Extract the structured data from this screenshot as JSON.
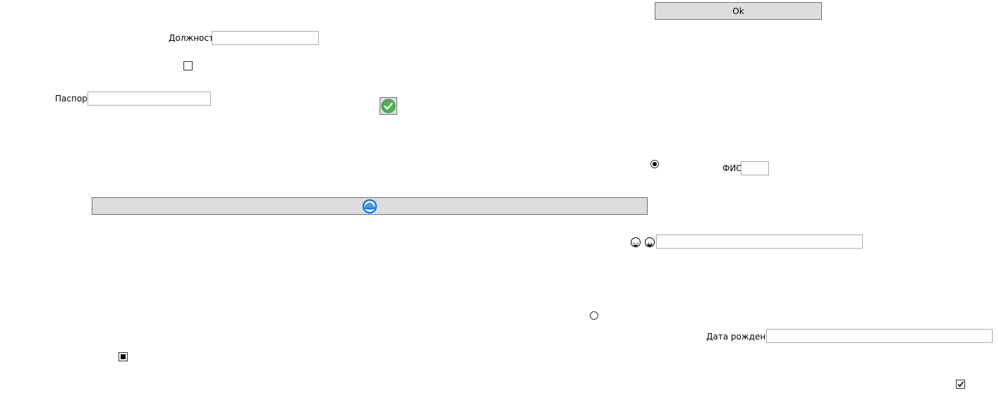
{
  "buttons": {
    "ok_label": "Ok",
    "loading_button_icon": "loading-spinner-icon",
    "confirm_image_button_icon": "green-check-icon"
  },
  "fields": {
    "position": {
      "label": "Должность",
      "value": ""
    },
    "passport": {
      "label": "Паспорт",
      "value": ""
    },
    "fio": {
      "label": "ФИО",
      "value": ""
    },
    "emoji_field": {
      "value": ""
    },
    "birth_date": {
      "label": "Дата рождения",
      "value": ""
    }
  },
  "checkboxes": {
    "checkbox_1": "unchecked",
    "checkbox_2": "indeterminate",
    "checkbox_3": "checked"
  },
  "radios": {
    "radio_1": "selected",
    "radio_2": "unselected"
  },
  "icons": {
    "emoji_1": "laughing-face-icon",
    "emoji_2": "grinning-face-icon"
  },
  "colors": {
    "button_bg": "#dddddd",
    "check_green": "#4caf50",
    "spinner_blue": "#1976d2"
  }
}
